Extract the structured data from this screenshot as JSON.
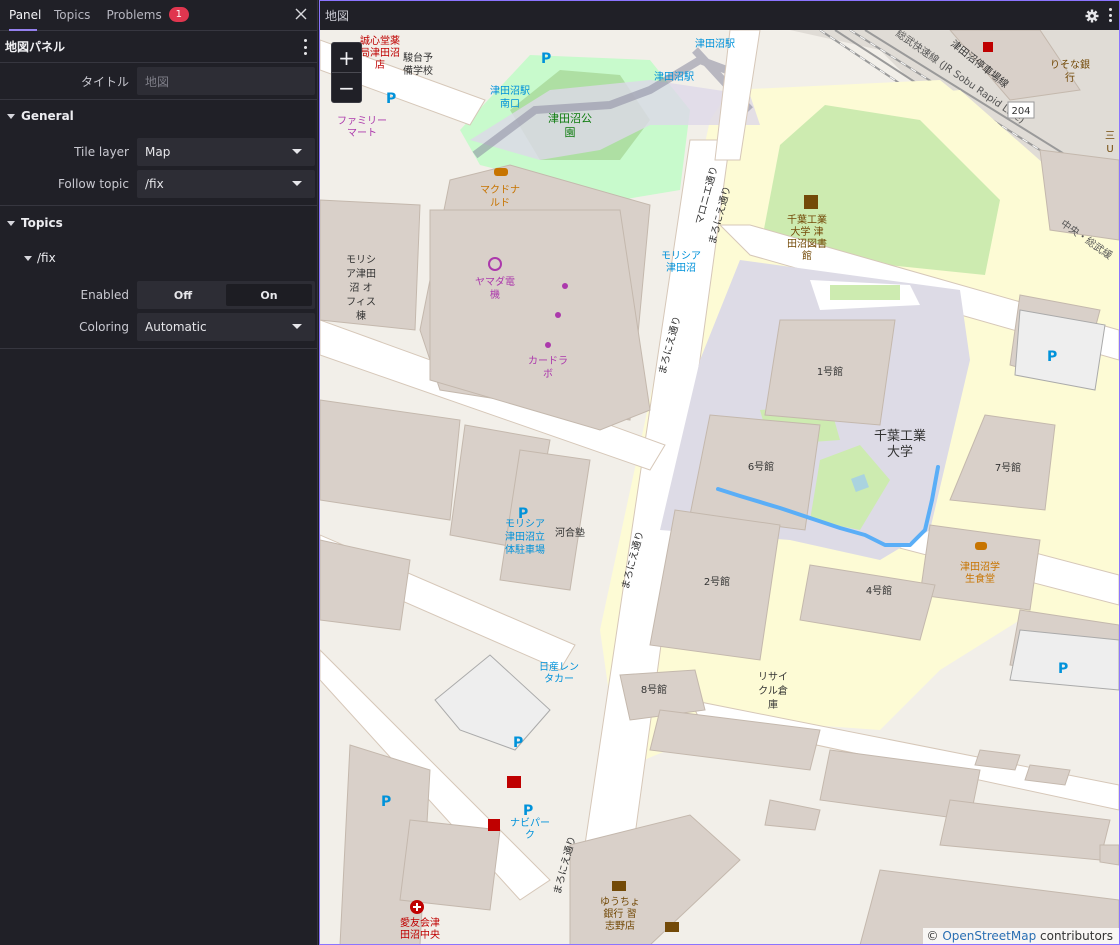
{
  "sidebar": {
    "tabs": [
      {
        "label": "Panel"
      },
      {
        "label": "Topics"
      },
      {
        "label": "Problems",
        "badge": "1"
      }
    ],
    "panel_title": "地図パネル",
    "title_field": {
      "label": "タイトル",
      "placeholder": "地図"
    },
    "general": {
      "header": "General",
      "tile_layer": {
        "label": "Tile layer",
        "value": "Map"
      },
      "follow_topic": {
        "label": "Follow topic",
        "value": "/fix"
      }
    },
    "topics": {
      "header": "Topics",
      "fix": {
        "name": "/fix",
        "enabled": {
          "label": "Enabled",
          "off": "Off",
          "on": "On",
          "selected": "On"
        },
        "coloring": {
          "label": "Coloring",
          "value": "Automatic"
        }
      }
    }
  },
  "map": {
    "title": "地図",
    "zoom_in": "+",
    "zoom_out": "−",
    "attribution": {
      "prefix": "©",
      "link": "OpenStreetMap",
      "suffix": "contributors"
    },
    "labels": {
      "chitech": "千葉工業\n大学",
      "library": "千葉工業\n大学 津\n田沼図書\n館",
      "b1": "1号館",
      "b6": "6号館",
      "b7": "7号館",
      "b2": "2号館",
      "b4": "4号館",
      "b8": "8号館",
      "recycle": "リサイ\nクル倉\n庫",
      "coop": "津田沼学\n生食堂",
      "park": "津田沼公\n園",
      "station1": "津田沼駅",
      "station2": "津田沼駅",
      "station3": "津田沼駅\n南口",
      "mcd": "マクドナ\nルド",
      "yamada": "ヤマダ電\n機",
      "cardlab": "カードラ\nボ",
      "morisia": "モリシ\nア津田\n沼 オ\nフィス\n棟",
      "morisia2": "モリシア\n津田沼",
      "parking1": "モリシア\n津田沼立\n体駐車場",
      "kawai": "河合塾",
      "nissan": "日産レン\nタカー",
      "navi": "ナビパー\nク",
      "yucho": "ゆうちょ\n銀行 習\n志野店",
      "aiyukai": "愛友会津\n田沼中央",
      "seishin": "誠心堂薬\n局津田沼\n店",
      "sundai": "駿台予\n備学校",
      "familymart": "ファミリー\nマート",
      "risona": "りそな銀\n行",
      "mitsubishi": "三\nU",
      "road1": "まろにえ通り",
      "road2": "まろにえ通り",
      "road3": "まろにえ通り",
      "road4": "まろにえ通り",
      "road5": "マロニエ通り",
      "rail1": "津田沼停車場線",
      "rail2": "総武快速線 (JR Sobu Rapid Line)",
      "rail3": "中央・総武緩",
      "route": "204"
    }
  },
  "colors": {
    "accent": "#9480ed",
    "badge": "#e0364f",
    "track": "#5aaef7",
    "building": "#d9d0c9",
    "campus": "#fdfbd5",
    "green": "#c8facc"
  }
}
